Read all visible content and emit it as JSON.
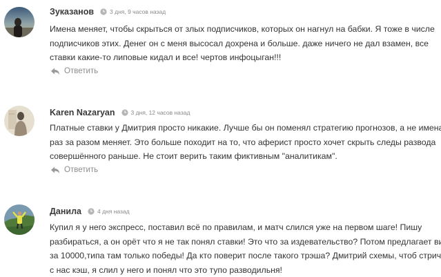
{
  "comments": [
    {
      "author": "Зуказанов",
      "date": "3 дня, 9 часов назад",
      "lines": [
        "Имена меняет, чтобы скрыться от злых подписчиков, которых он нагнул на бабки. Я тоже в числе",
        "подписчиков этих. Денег он с меня высосал дохрена и больше. даже ничего не дал взамен, все",
        "ставки какие-то липовые кидал и все! чертов инфоцыган!!!"
      ],
      "reply_label": "Ответить",
      "avatar_colors": [
        "#3d5a7a",
        "#8fa3a8",
        "#2a2622"
      ]
    },
    {
      "author": "Karen Nazaryan",
      "date": "3 дня, 12 часов назад",
      "lines": [
        "Платные ставки у Дмитрия просто никакие. Лучше бы он поменял стратегию прогнозов, а не имена",
        "раз за разом меняет. Это больше походит на то, что аферист просто хочет скрыть следы развода",
        "совершённого раньше. Не стоит верить таким фиктивным \"аналитикам\"."
      ],
      "reply_label": "Ответить",
      "avatar_colors": [
        "#e6dfd0",
        "#9a8c78",
        "#5a4f44"
      ]
    },
    {
      "author": "Данила",
      "date": "4 дня назад",
      "lines": [
        "Купил я у него экспресс, поставил всё по правилам, и матч слился уже на первом шаге! Пишу",
        "разбираться, а он орёт что я не так понял ставки! Это что за издевательство? Потом предлагает вип",
        "за 10000,типа там только победы! Да кто поверит после такого трэша? Дмитрий схемы, чтоб стричь",
        "с нас кэш, я слил у него и понял что это тупо разводильня!"
      ],
      "avatar_colors": [
        "#7a9ab0",
        "#4f7a3a",
        "#e8e04a"
      ]
    }
  ]
}
